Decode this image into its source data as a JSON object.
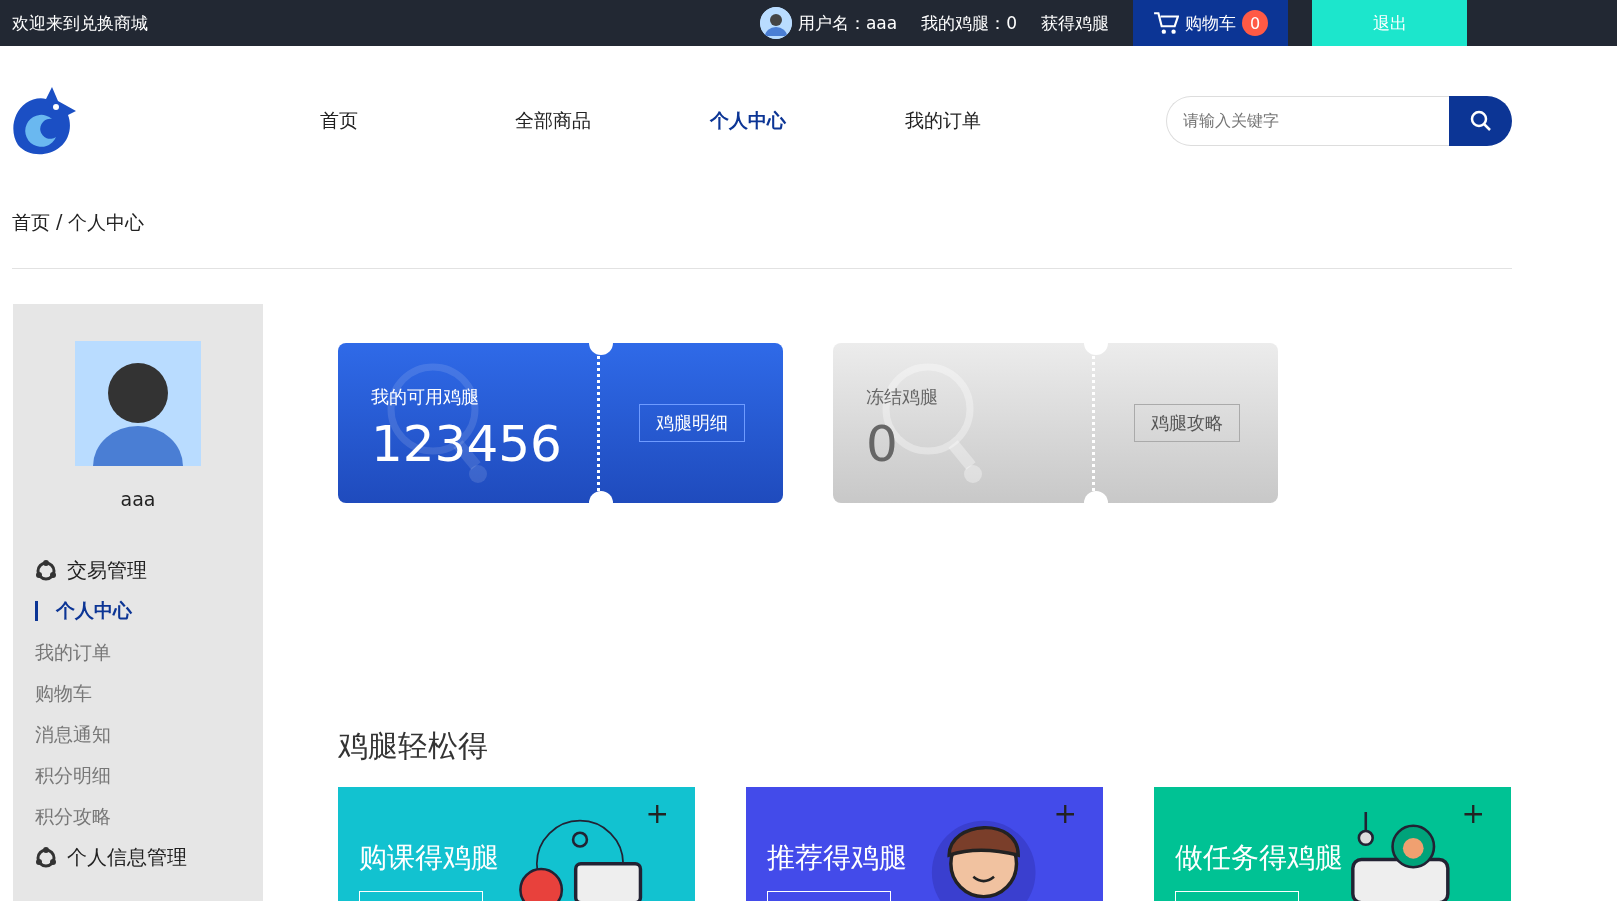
{
  "top_bar": {
    "welcome": "欢迎来到兑换商城",
    "username": "用户名：aaa",
    "points": "我的鸡腿：0",
    "earn_link": "获得鸡腿",
    "cart": {
      "label": "购物车",
      "count": "0"
    },
    "logout": "退出"
  },
  "nav": {
    "items": [
      {
        "label": "首页",
        "selected": false
      },
      {
        "label": "全部商品",
        "selected": false
      },
      {
        "label": "个人中心",
        "selected": true
      },
      {
        "label": "我的订单",
        "selected": false
      }
    ]
  },
  "search": {
    "placeholder": "请输入关键字"
  },
  "breadcrumb": {
    "items": [
      "首页",
      "个人中心"
    ],
    "separator": "/"
  },
  "sidebar": {
    "username": "aaa",
    "groups": [
      {
        "title": "交易管理",
        "items": [
          {
            "label": "个人中心",
            "selected": true
          },
          {
            "label": "我的订单",
            "selected": false
          },
          {
            "label": "购物车",
            "selected": false
          },
          {
            "label": "消息通知",
            "selected": false
          },
          {
            "label": "积分明细",
            "selected": false
          },
          {
            "label": "积分攻略",
            "selected": false
          }
        ]
      },
      {
        "title": "个人信息管理"
      }
    ]
  },
  "balance_cards": [
    {
      "kind": "available",
      "title": "我的可用鸡腿",
      "value": "123456",
      "button": "鸡腿明细"
    },
    {
      "kind": "frozen",
      "title": "冻结鸡腿",
      "value": "0",
      "button": "鸡腿攻略"
    }
  ],
  "earn_section": {
    "title": "鸡腿轻松得",
    "cards": [
      {
        "kind": "course",
        "title": "购课得鸡腿",
        "plus": "+",
        "color": "#12c2d0"
      },
      {
        "kind": "referral",
        "title": "推荐得鸡腿",
        "plus": "+",
        "color": "#434bea"
      },
      {
        "kind": "task",
        "title": "做任务得鸡腿",
        "plus": "+",
        "color": "#00c294"
      }
    ]
  }
}
